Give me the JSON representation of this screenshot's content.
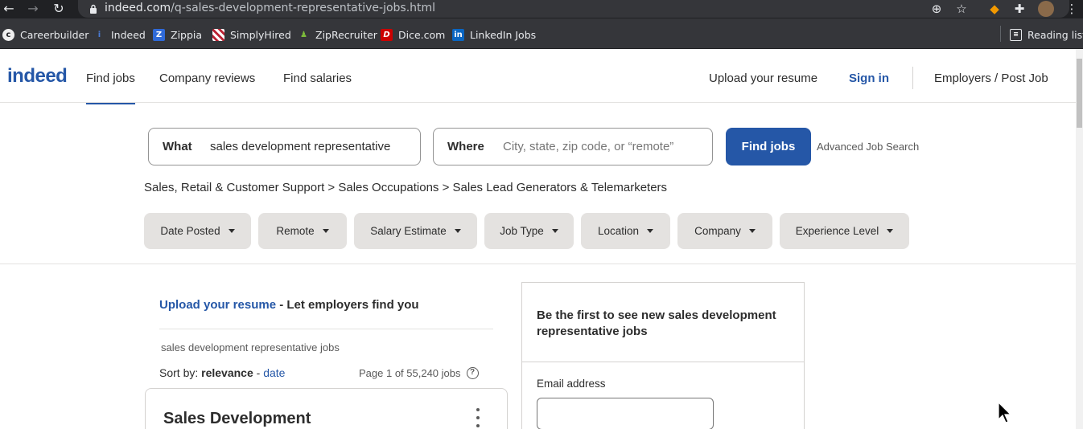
{
  "browser": {
    "url_domain": "indeed.com",
    "url_path": "/q-sales-development-representative-jobs.html",
    "bookmarks": [
      {
        "label": "Careerbuilder",
        "icon": "careerbuilder-icon"
      },
      {
        "label": "Indeed",
        "icon": "indeed-icon"
      },
      {
        "label": "Zippia",
        "icon": "zippia-icon"
      },
      {
        "label": "SimplyHired",
        "icon": "simplyhired-icon"
      },
      {
        "label": "ZipRecruiter",
        "icon": "ziprecruiter-icon"
      },
      {
        "label": "Dice.com",
        "icon": "dice-icon"
      },
      {
        "label": "LinkedIn Jobs",
        "icon": "linkedin-icon"
      }
    ],
    "reading_list": "Reading list"
  },
  "header": {
    "logo": "indeed",
    "nav": [
      "Find jobs",
      "Company reviews",
      "Find salaries"
    ],
    "upload_resume": "Upload your resume",
    "sign_in": "Sign in",
    "employers": "Employers / Post Job"
  },
  "search": {
    "what_label": "What",
    "what_value": "sales development representative",
    "where_label": "Where",
    "where_placeholder": "City, state, zip code, or “remote”",
    "find_button": "Find jobs",
    "advanced": "Advanced Job Search"
  },
  "breadcrumb": "Sales, Retail & Customer Support > Sales Occupations > Sales Lead Generators & Telemarketers",
  "filters": [
    "Date Posted",
    "Remote",
    "Salary Estimate",
    "Job Type",
    "Location",
    "Company",
    "Experience Level"
  ],
  "results": {
    "upload_link": "Upload your resume",
    "upload_tail": " - Let employers find you",
    "query_caption": "sales development representative jobs",
    "sort_prefix": "Sort by: ",
    "sort_active": "relevance",
    "sort_sep": " - ",
    "sort_other": "date",
    "page_info": "Page 1 of 55,240 jobs",
    "first_job_title": "Sales Development"
  },
  "alert": {
    "title": "Be the first to see new sales development representative jobs",
    "email_label": "Email address"
  },
  "colors": {
    "brand_blue": "#2557a7",
    "chrome_dark": "#202124",
    "filter_bg": "#e4e2e0"
  }
}
